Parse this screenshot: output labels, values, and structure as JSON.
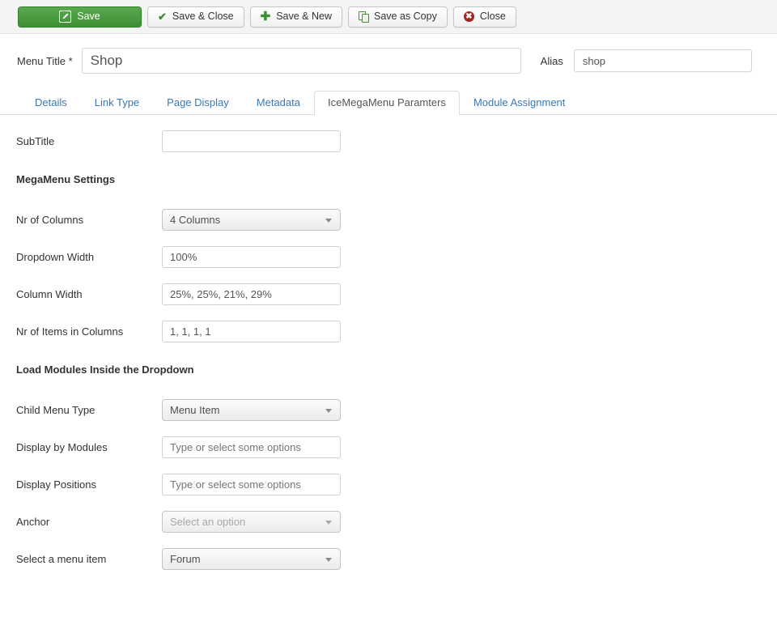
{
  "toolbar": {
    "buttons": [
      {
        "label": "Save",
        "icon": "edit-icon",
        "name": "save-button"
      },
      {
        "label": "Save & Close",
        "icon": "check-icon",
        "name": "save-and-close-button"
      },
      {
        "label": "Save & New",
        "icon": "plus-icon",
        "name": "save-and-new-button"
      },
      {
        "label": "Save as Copy",
        "icon": "copy-icon",
        "name": "save-as-copy-button"
      },
      {
        "label": "Close",
        "icon": "close-icon",
        "name": "close-button"
      }
    ],
    "save_accent_color": "#3f8f36",
    "close_accent_color": "#a32424"
  },
  "header": {
    "menu_title_label": "Menu Title *",
    "menu_title_value": "Shop",
    "alias_label": "Alias",
    "alias_value": "shop"
  },
  "tabs": [
    {
      "label": "Details",
      "active": false
    },
    {
      "label": "Link Type",
      "active": false
    },
    {
      "label": "Page Display",
      "active": false
    },
    {
      "label": "Metadata",
      "active": false
    },
    {
      "label": "IceMegaMenu Paramters",
      "active": true
    },
    {
      "label": "Module Assignment",
      "active": false
    }
  ],
  "form": {
    "subtitle": {
      "label": "SubTitle",
      "value": ""
    },
    "megamenu_section_title": "MegaMenu Settings",
    "nr_of_columns": {
      "label": "Nr of Columns",
      "value": "4 Columns"
    },
    "dropdown_width": {
      "label": "Dropdown Width",
      "value": "100%"
    },
    "column_width": {
      "label": "Column Width",
      "value": "25%, 25%, 21%, 29%"
    },
    "nr_of_items_in_columns": {
      "label": "Nr of Items in Columns",
      "value": "1, 1, 1, 1"
    },
    "load_modules_section_title": "Load Modules Inside the Dropdown",
    "child_menu_type": {
      "label": "Child Menu Type",
      "value": "Menu Item"
    },
    "display_by_modules": {
      "label": "Display by Modules",
      "placeholder": "Type or select some options",
      "value": ""
    },
    "display_positions": {
      "label": "Display Positions",
      "placeholder": "Type or select some options",
      "value": ""
    },
    "anchor": {
      "label": "Anchor",
      "value": "Select an option"
    },
    "select_a_menu_item": {
      "label": "Select a menu item",
      "value": "Forum"
    }
  }
}
